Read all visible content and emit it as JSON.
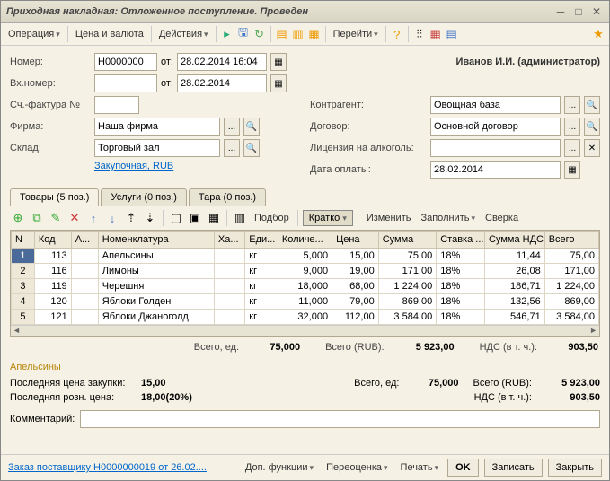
{
  "window": {
    "title": "Приходная накладная: Отложенное поступление. Проведен"
  },
  "toolbar": {
    "operation": "Операция",
    "price": "Цена и валюта",
    "actions": "Действия",
    "goto": "Перейти"
  },
  "user": "Иванов И.И. (администратор)",
  "form": {
    "number_lbl": "Номер:",
    "number": "Н0000000",
    "from_lbl": "от:",
    "date1": "28.02.2014 16:04",
    "in_number_lbl": "Вх.номер:",
    "in_number": "",
    "date2": "28.02.2014",
    "invoice_lbl": "Сч.-фактура №",
    "invoice": "",
    "firm_lbl": "Фирма:",
    "firm": "Наша фирма",
    "warehouse_lbl": "Склад:",
    "warehouse": "Торговый зал",
    "pricetype": "Закупочная, RUB",
    "contragent_lbl": "Контрагент:",
    "contragent": "Овощная база",
    "contract_lbl": "Договор:",
    "contract": "Основной договор",
    "license_lbl": "Лицензия на алкоголь:",
    "license": "",
    "paydate_lbl": "Дата оплаты:",
    "paydate": "28.02.2014"
  },
  "tabs": {
    "goods": "Товары (5 поз.)",
    "services": "Услуги (0 поз.)",
    "tare": "Тара (0 поз.)"
  },
  "grid_toolbar": {
    "select": "Подбор",
    "brief": "Кратко",
    "change": "Изменить",
    "fill": "Заполнить",
    "reconcile": "Сверка"
  },
  "grid": {
    "cols": {
      "n": "N",
      "code": "Код",
      "a": "А...",
      "nom": "Номенклатура",
      "ha": "Ха...",
      "ed": "Еди...",
      "qty": "Количе...",
      "price": "Цена",
      "sum": "Сумма",
      "rate": "Ставка ...",
      "vat": "Сумма НДС",
      "total": "Всего"
    },
    "rows": [
      {
        "n": "1",
        "code": "113",
        "nom": "Апельсины",
        "ed": "кг",
        "qty": "5,000",
        "price": "15,00",
        "sum": "75,00",
        "rate": "18%",
        "vat": "11,44",
        "total": "75,00"
      },
      {
        "n": "2",
        "code": "116",
        "nom": "Лимоны",
        "ed": "кг",
        "qty": "9,000",
        "price": "19,00",
        "sum": "171,00",
        "rate": "18%",
        "vat": "26,08",
        "total": "171,00"
      },
      {
        "n": "3",
        "code": "119",
        "nom": "Черешня",
        "ed": "кг",
        "qty": "18,000",
        "price": "68,00",
        "sum": "1 224,00",
        "rate": "18%",
        "vat": "186,71",
        "total": "1 224,00"
      },
      {
        "n": "4",
        "code": "120",
        "nom": "Яблоки Голден",
        "ed": "кг",
        "qty": "11,000",
        "price": "79,00",
        "sum": "869,00",
        "rate": "18%",
        "vat": "132,56",
        "total": "869,00"
      },
      {
        "n": "5",
        "code": "121",
        "nom": "Яблоки Джаноголд",
        "ed": "кг",
        "qty": "32,000",
        "price": "112,00",
        "sum": "3 584,00",
        "rate": "18%",
        "vat": "546,71",
        "total": "3 584,00"
      }
    ]
  },
  "totals": {
    "qty_lbl": "Всего, ед:",
    "qty": "75,000",
    "sum_lbl": "Всего (RUB):",
    "sum": "5 923,00",
    "vat_lbl": "НДС (в т. ч.):",
    "vat": "903,50"
  },
  "detail": {
    "title": "Апельсины",
    "last_purchase_lbl": "Последняя цена закупки:",
    "last_purchase": "15,00",
    "last_retail_lbl": "Последняя розн. цена:",
    "last_retail": "18,00(20%)",
    "qty_lbl": "Всего, ед:",
    "qty": "75,000",
    "sum_lbl": "Всего (RUB):",
    "sum": "5 923,00",
    "vat_lbl": "НДС (в т. ч.):",
    "vat": "903,50"
  },
  "comment_lbl": "Комментарий:",
  "footer": {
    "order_link": "Заказ поставщику Н0000000019 от 26.02....",
    "extra": "Доп. функции",
    "reval": "Переоценка",
    "print": "Печать",
    "ok": "OK",
    "save": "Записать",
    "close": "Закрыть"
  }
}
